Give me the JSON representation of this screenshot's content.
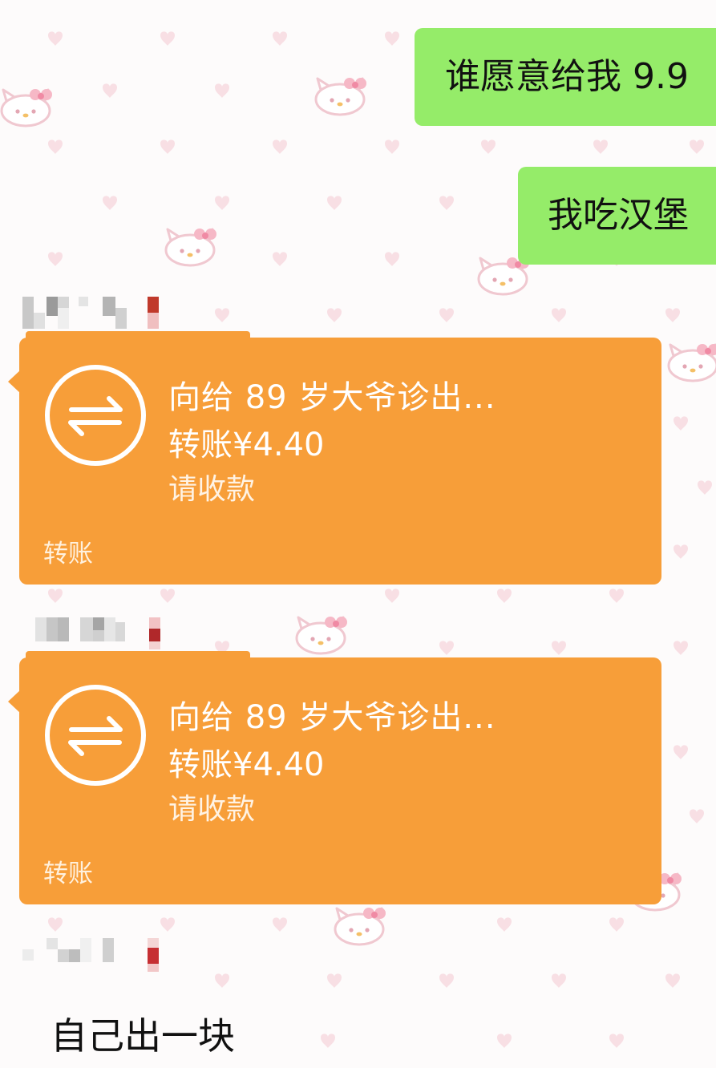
{
  "chat": {
    "outgoing": [
      {
        "text": "谁愿意给我 9.9"
      },
      {
        "text": "我吃汉堡"
      }
    ],
    "transfers": [
      {
        "title": "向给 89 岁大爷诊出...",
        "amount": "转账¥4.40",
        "status": "请收款",
        "footer": "转账"
      },
      {
        "title": "向给 89 岁大爷诊出...",
        "amount": "转账¥4.40",
        "status": "请收款",
        "footer": "转账"
      }
    ],
    "incoming_text": "自己出一块"
  },
  "theme": {
    "outgoing_bubble": "#95ec69",
    "transfer_card": "#f79e39",
    "background": "#fdfbfb",
    "pattern_heart": "#f8dfe4",
    "pattern_icon": "kitty-face-icon"
  }
}
